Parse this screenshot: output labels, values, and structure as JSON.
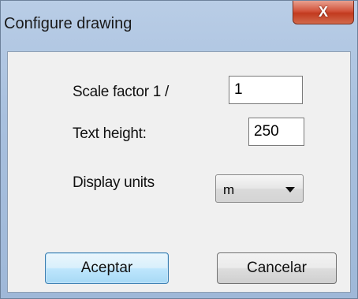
{
  "window": {
    "title": "Configure drawing",
    "close_label": "X"
  },
  "form": {
    "scale_label": "Scale factor 1 /",
    "scale_value": "1",
    "text_height_label": "Text height:",
    "text_height_value": "250",
    "units_label": "Display units",
    "units_selected": "m"
  },
  "buttons": {
    "ok_label": "Aceptar",
    "cancel_label": "Cancelar"
  }
}
